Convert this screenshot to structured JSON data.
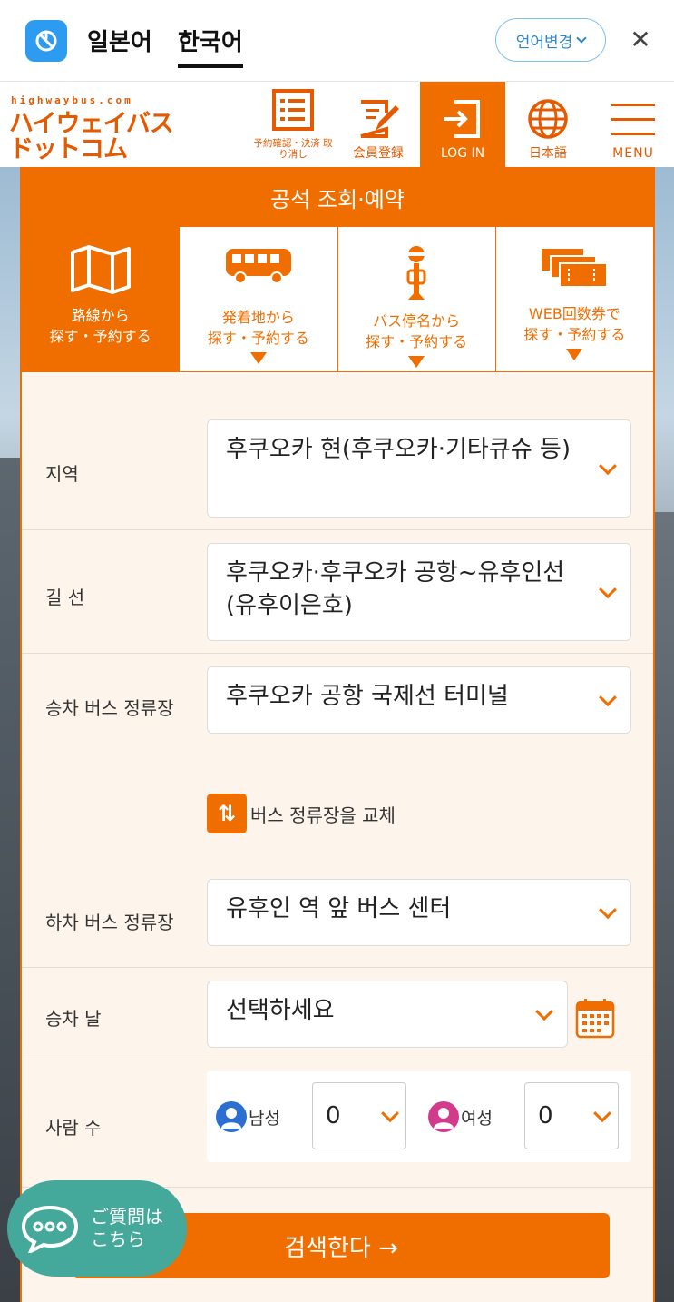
{
  "translate_bar": {
    "source_lang": "일본어",
    "target_lang": "한국어",
    "change_button": "언어변경",
    "close_icon": "close-icon"
  },
  "site": {
    "brand_small": "highwaybus.com",
    "brand_line1": "ハイウェイバス",
    "brand_line2": "ドットコム",
    "nav": [
      {
        "label": "予約確認・決済 取り消し",
        "icon": "list-icon"
      },
      {
        "label": "会員登録",
        "icon": "edit-icon"
      },
      {
        "label": "LOG IN",
        "icon": "login-icon"
      },
      {
        "label": "日本語",
        "icon": "globe-icon"
      },
      {
        "label": "MENU",
        "icon": "hamburger-icon"
      }
    ]
  },
  "panel": {
    "title": "공석 조회·예약",
    "tabs": [
      {
        "line1": "路線から",
        "line2": "探す・予約する",
        "icon": "map-icon"
      },
      {
        "line1": "発着地から",
        "line2": "探す・予約する",
        "icon": "bus-icon"
      },
      {
        "line1": "バス停名から",
        "line2": "探す・予約する",
        "icon": "bus-stop-icon"
      },
      {
        "line1": "WEB回数券で",
        "line2": "探す・予約する",
        "icon": "tickets-icon"
      }
    ]
  },
  "form": {
    "region": {
      "label": "지역",
      "value": "후쿠오카 현(후쿠오카·기타큐슈 등)"
    },
    "route": {
      "label": "길 선",
      "value": "후쿠오카·후쿠오카 공항~유후인선(유후이은호)"
    },
    "boarding_stop": {
      "label": "승차 버스 정류장",
      "value": "후쿠오카 공항 국제선 터미널"
    },
    "swap_label": "버스 정류장을 교체",
    "alighting_stop": {
      "label": "하차 버스 정류장",
      "value": "유후인 역 앞 버스 센터"
    },
    "date": {
      "label": "승차 날",
      "value": "선택하세요"
    },
    "people": {
      "label": "사람 수",
      "male_label": "남성",
      "male_value": "0",
      "female_label": "여성",
      "female_value": "0"
    },
    "search_label": "검색한다 →"
  },
  "chat": {
    "line1": "ご質問は",
    "line2": "こちら"
  },
  "colors": {
    "accent": "#f06d00",
    "panel_bg": "#fdf4ec",
    "chat": "#44a99a",
    "translate_blue": "#2d9cf0"
  }
}
